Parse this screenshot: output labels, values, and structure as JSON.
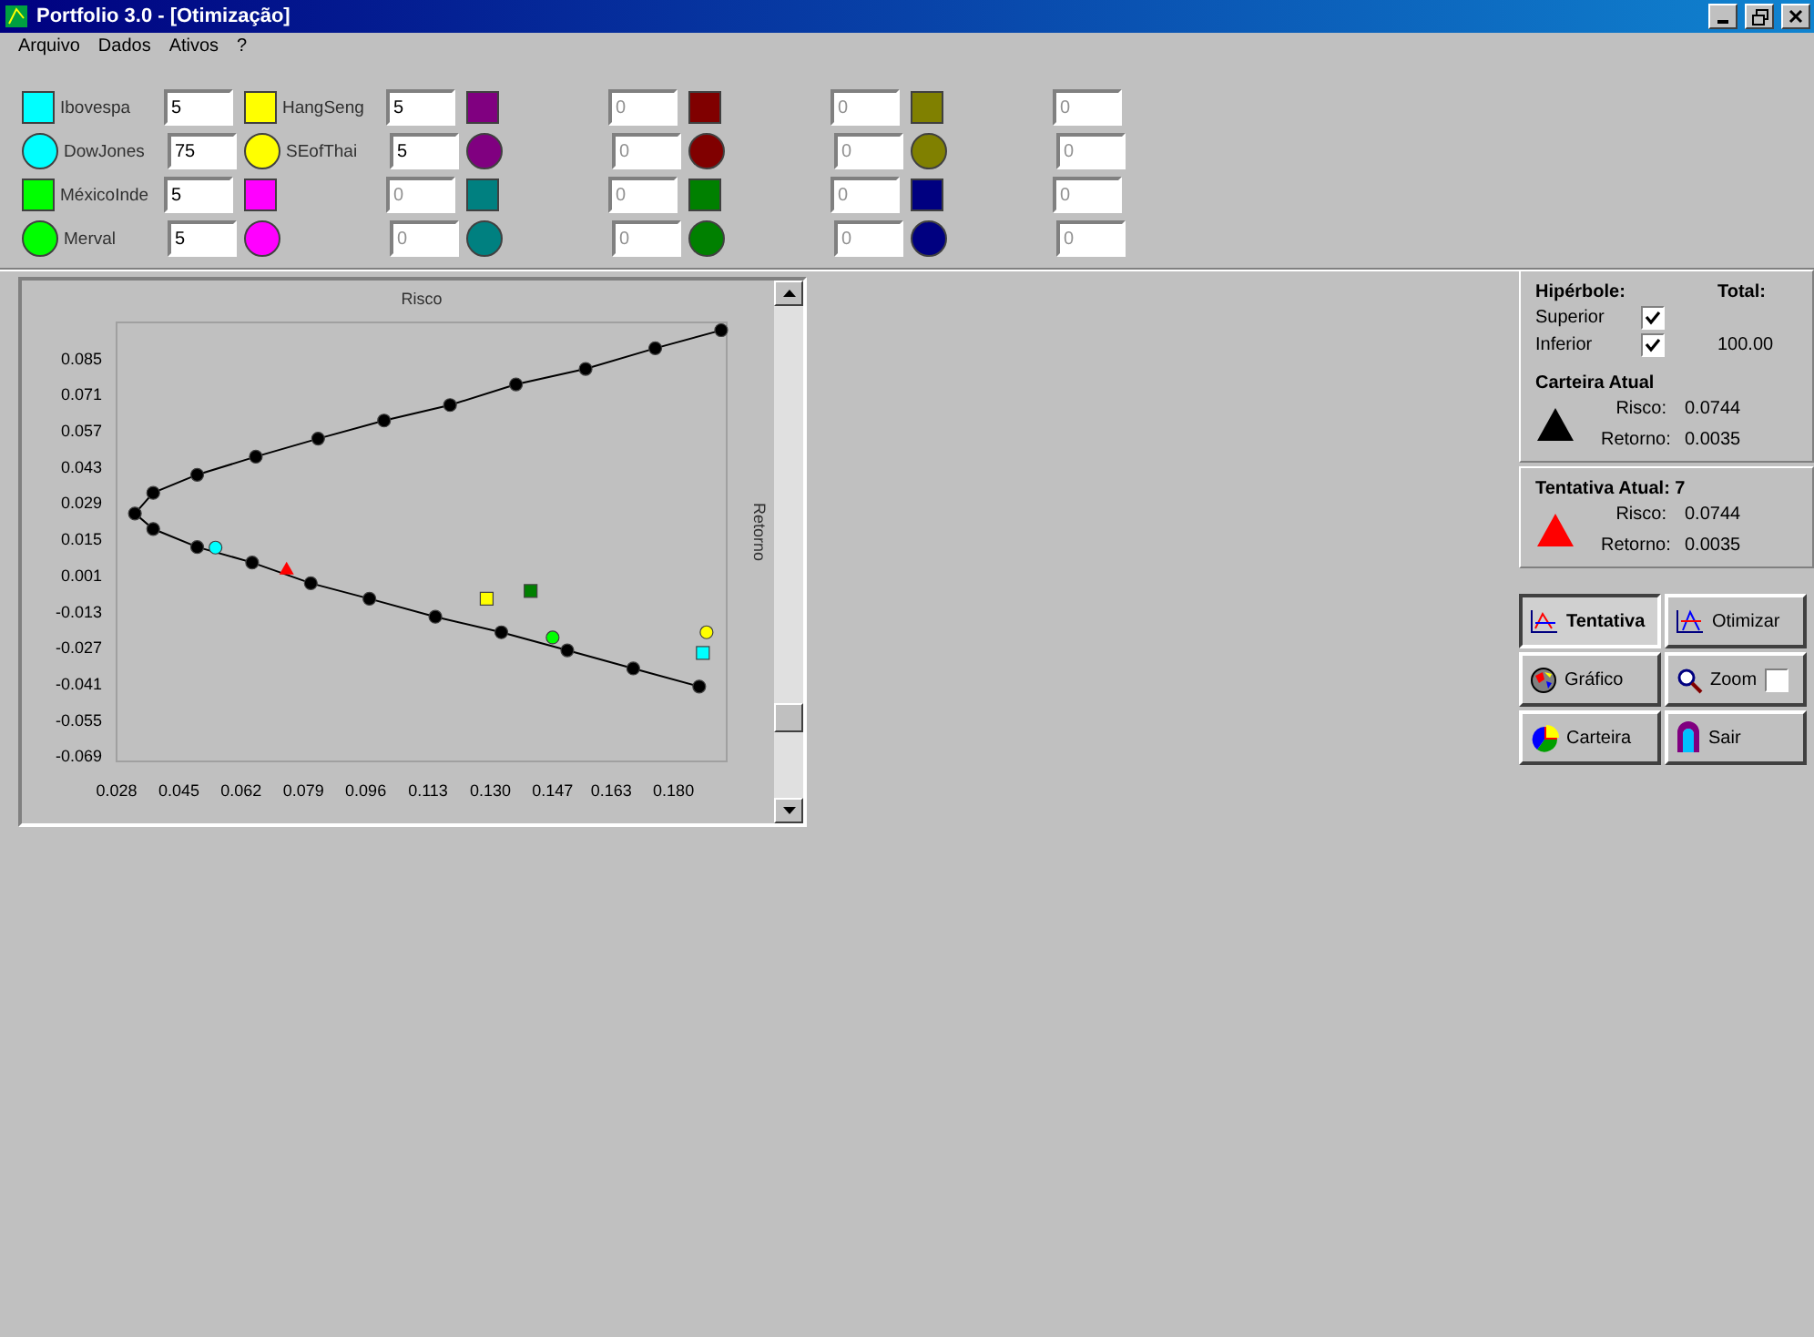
{
  "window": {
    "title": "Portfolio 3.0 - [Otimização]"
  },
  "menu": [
    "Arquivo",
    "Dados",
    "Ativos",
    "?"
  ],
  "asset_groups": [
    {
      "items": [
        {
          "kind": "square",
          "color": "#00ffff",
          "label": "Ibovespa",
          "value": "5",
          "disabled": false
        },
        {
          "kind": "circle",
          "color": "#00ffff",
          "label": "DowJones",
          "value": "75",
          "disabled": false
        },
        {
          "kind": "square",
          "color": "#00ff00",
          "label": "MéxicoInde",
          "value": "5",
          "disabled": false
        },
        {
          "kind": "circle",
          "color": "#00ff00",
          "label": "Merval",
          "value": "5",
          "disabled": false
        }
      ]
    },
    {
      "items": [
        {
          "kind": "square",
          "color": "#ffff00",
          "label": "HangSeng",
          "value": "5",
          "disabled": false
        },
        {
          "kind": "circle",
          "color": "#ffff00",
          "label": "SEofThai",
          "value": "5",
          "disabled": false
        },
        {
          "kind": "square",
          "color": "#ff00ff",
          "value": "0",
          "disabled": true
        },
        {
          "kind": "circle",
          "color": "#ff00ff",
          "value": "0",
          "disabled": true
        }
      ]
    },
    {
      "items": [
        {
          "kind": "square",
          "color": "#800080",
          "value": "0",
          "disabled": true
        },
        {
          "kind": "circle",
          "color": "#800080",
          "value": "0",
          "disabled": true
        },
        {
          "kind": "square",
          "color": "#008080",
          "value": "0",
          "disabled": true
        },
        {
          "kind": "circle",
          "color": "#008080",
          "value": "0",
          "disabled": true
        }
      ]
    },
    {
      "items": [
        {
          "kind": "square",
          "color": "#800000",
          "value": "0",
          "disabled": true
        },
        {
          "kind": "circle",
          "color": "#800000",
          "value": "0",
          "disabled": true
        },
        {
          "kind": "square",
          "color": "#008000",
          "value": "0",
          "disabled": true
        },
        {
          "kind": "circle",
          "color": "#008000",
          "value": "0",
          "disabled": true
        }
      ]
    },
    {
      "items": [
        {
          "kind": "square",
          "color": "#808000",
          "value": "0",
          "disabled": true
        },
        {
          "kind": "circle",
          "color": "#808000",
          "value": "0",
          "disabled": true
        },
        {
          "kind": "square",
          "color": "#000080",
          "value": "0",
          "disabled": true
        },
        {
          "kind": "circle",
          "color": "#000080",
          "value": "0",
          "disabled": true
        }
      ]
    }
  ],
  "chart": {
    "chart_data": {
      "type": "line",
      "xlabel": "Risco",
      "ylabel": "Retorno",
      "xlim": [
        0.028,
        0.1945
      ],
      "ylim": [
        -0.071,
        0.099
      ],
      "xticks": [
        {
          "value": 0.028,
          "label": "0.028"
        },
        {
          "value": 0.045,
          "label": "0.045"
        },
        {
          "value": 0.062,
          "label": "0.062"
        },
        {
          "value": 0.079,
          "label": "0.079"
        },
        {
          "value": 0.096,
          "label": "0.096"
        },
        {
          "value": 0.113,
          "label": "0.113"
        },
        {
          "value": 0.13,
          "label": "0.130"
        },
        {
          "value": 0.147,
          "label": "0.147"
        },
        {
          "value": 0.163,
          "label": "0.163"
        },
        {
          "value": 0.18,
          "label": "0.180"
        }
      ],
      "yticks": [
        {
          "value": 0.085,
          "label": "0.085"
        },
        {
          "value": 0.071,
          "label": "0.071"
        },
        {
          "value": 0.057,
          "label": "0.057"
        },
        {
          "value": 0.043,
          "label": "0.043"
        },
        {
          "value": 0.029,
          "label": "0.029"
        },
        {
          "value": 0.015,
          "label": "0.015"
        },
        {
          "value": 0.001,
          "label": "0.001"
        },
        {
          "value": -0.013,
          "label": "-0.013"
        },
        {
          "value": -0.027,
          "label": "-0.027"
        },
        {
          "value": -0.041,
          "label": "-0.041"
        },
        {
          "value": -0.055,
          "label": "-0.055"
        },
        {
          "value": -0.069,
          "label": "-0.069"
        }
      ],
      "series": [
        {
          "color": "#000000",
          "marker": "circle",
          "x": [
            0.193,
            0.175,
            0.156,
            0.137,
            0.119,
            0.101,
            0.083,
            0.066,
            0.05,
            0.038,
            0.033,
            0.038,
            0.05,
            0.065,
            0.081,
            0.097,
            0.115,
            0.133,
            0.151,
            0.169,
            0.187
          ],
          "values": [
            0.096,
            0.089,
            0.081,
            0.075,
            0.067,
            0.061,
            0.054,
            0.047,
            0.04,
            0.033,
            0.025,
            0.019,
            0.012,
            0.006,
            -0.002,
            -0.008,
            -0.015,
            -0.021,
            -0.028,
            -0.035,
            -0.042
          ]
        },
        {
          "color": "#00ffff",
          "marker": "circle",
          "x": [
            0.055
          ],
          "values": [
            0.0118
          ]
        },
        {
          "color": "#ff0000",
          "marker": "triangle",
          "x": [
            0.0744
          ],
          "values": [
            0.0035
          ]
        },
        {
          "color": "#ffff00",
          "marker": "square",
          "x": [
            0.129
          ],
          "values": [
            -0.008
          ]
        },
        {
          "color": "#008000",
          "marker": "square",
          "x": [
            0.141
          ],
          "values": [
            -0.005
          ]
        },
        {
          "color": "#00ff00",
          "marker": "circle",
          "x": [
            0.147
          ],
          "values": [
            -0.023
          ]
        },
        {
          "color": "#ffff00",
          "marker": "circle",
          "x": [
            0.189
          ],
          "values": [
            -0.021
          ]
        },
        {
          "color": "#00ffff",
          "marker": "square",
          "x": [
            0.188
          ],
          "values": [
            -0.029
          ]
        }
      ]
    }
  },
  "hyperbola": {
    "title": "Hipérbole:",
    "options": [
      {
        "label": "Superior",
        "checked": true
      },
      {
        "label": "Inferior",
        "checked": true
      }
    ],
    "total_label": "Total:",
    "total": "100.00"
  },
  "current": {
    "title": "Carteira Atual",
    "color": "#000000",
    "risk_label": "Risco:",
    "risk": "0.0744",
    "return_label": "Retorno:",
    "return": "0.0035"
  },
  "attempt": {
    "title": "Tentativa Atual: 7",
    "color": "#ff0000",
    "risk_label": "Risco:",
    "risk": "0.0744",
    "return_label": "Retorno:",
    "return": "0.0035"
  },
  "buttons": [
    {
      "label": "Tentativa",
      "pressed": true
    },
    {
      "label": "Otimizar",
      "pressed": false
    },
    {
      "label": "Gráfico",
      "pressed": false
    },
    {
      "label": "Zoom",
      "pressed": false,
      "checkbox": {
        "checked": false
      }
    },
    {
      "label": "Carteira",
      "pressed": false
    },
    {
      "label": "Sair",
      "pressed": false
    }
  ]
}
